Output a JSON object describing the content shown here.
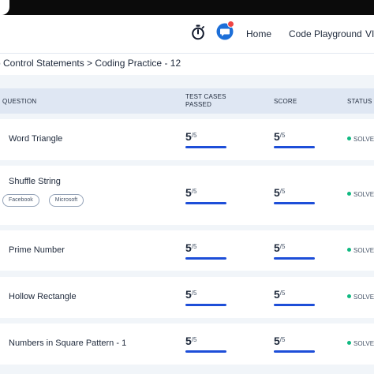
{
  "navbar": {
    "links": [
      "Home",
      "Code Playground",
      "VI"
    ],
    "icons": [
      "stopwatch-icon",
      "chat-icon"
    ],
    "accent": "#1d6fd8",
    "notification_color": "#ef4444"
  },
  "breadcrumb": "p Control Statements > Coding Practice - 12",
  "table": {
    "headers": {
      "question": "QUESTION",
      "tests_line1": "TEST CASES",
      "tests_line2": "PASSED",
      "score": "SCORE",
      "status": "STATUS"
    },
    "rows": [
      {
        "title": "Word Triangle",
        "tests": "5",
        "tests_total": "/5",
        "score": "5",
        "score_total": "/5",
        "status": "SOLVE",
        "tags": []
      },
      {
        "title": "Shuffle String",
        "tests": "5",
        "tests_total": "/5",
        "score": "5",
        "score_total": "/5",
        "status": "SOLVE",
        "tags": [
          "Facebook",
          "Microsoft"
        ]
      },
      {
        "title": "Prime Number",
        "tests": "5",
        "tests_total": "/5",
        "score": "5",
        "score_total": "/5",
        "status": "SOLVE",
        "tags": []
      },
      {
        "title": "Hollow Rectangle",
        "tests": "5",
        "tests_total": "/5",
        "score": "5",
        "score_total": "/5",
        "status": "SOLVE",
        "tags": []
      },
      {
        "title": "Numbers in Square Pattern - 1",
        "tests": "5",
        "tests_total": "/5",
        "score": "5",
        "score_total": "/5",
        "status": "SOLVE",
        "tags": []
      }
    ],
    "progress_fraction": 1.0,
    "progress_color": "#1d4ed8",
    "solved_color": "#10b981"
  }
}
